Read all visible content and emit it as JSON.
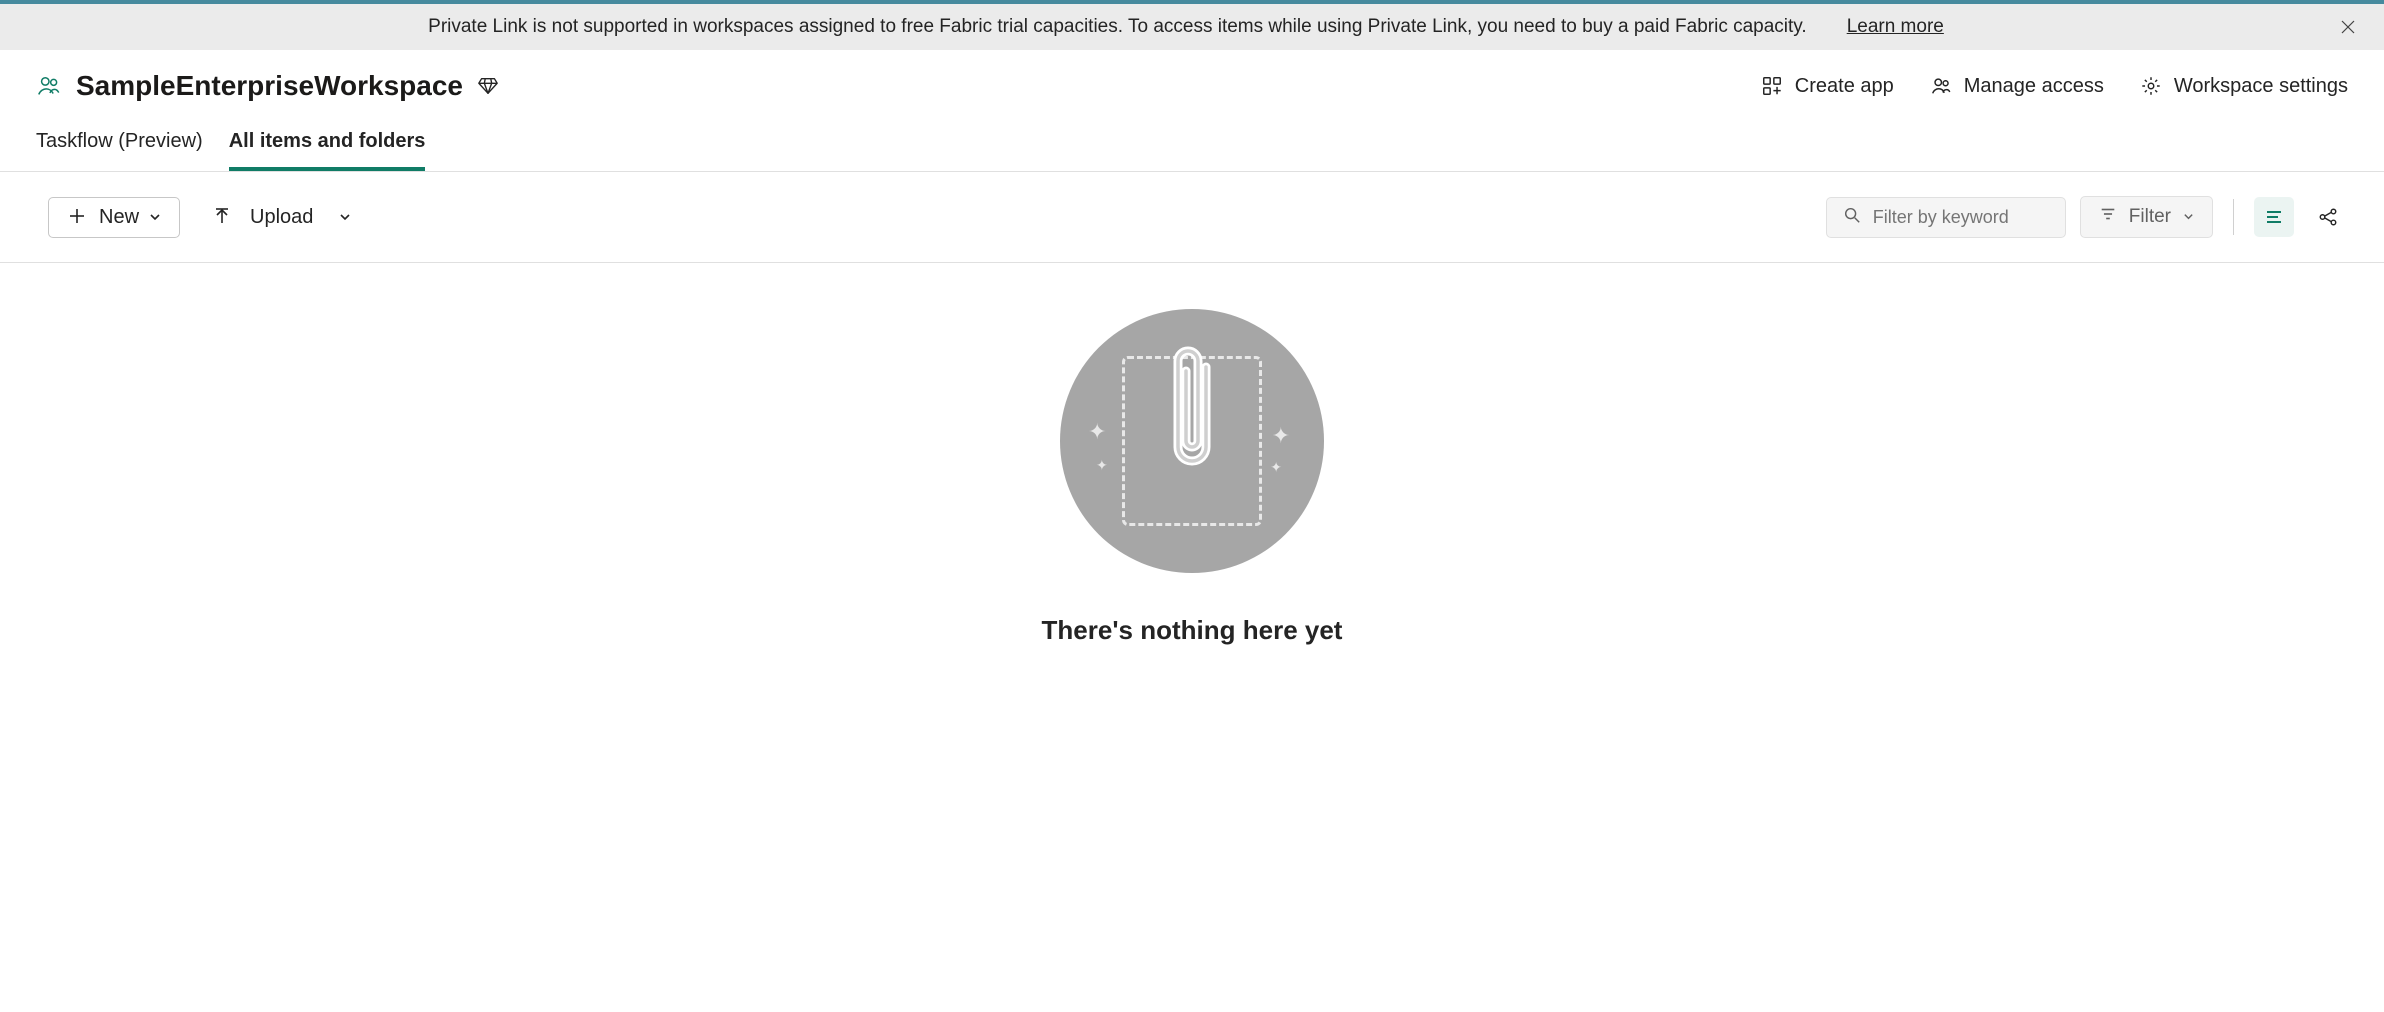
{
  "notification": {
    "message": "Private Link is not supported in workspaces assigned to free Fabric trial capacities. To access items while using Private Link, you need to buy a paid Fabric capacity.",
    "learn_more": "Learn more"
  },
  "workspace": {
    "title": "SampleEnterpriseWorkspace"
  },
  "header_actions": {
    "create_app": "Create app",
    "manage_access": "Manage access",
    "workspace_settings": "Workspace settings"
  },
  "tabs": {
    "taskflow": "Taskflow (Preview)",
    "all_items": "All items and folders"
  },
  "toolbar": {
    "new_label": "New",
    "upload_label": "Upload",
    "filter_placeholder": "Filter by keyword",
    "filter_btn": "Filter"
  },
  "empty_state": {
    "title": "There's nothing here yet"
  },
  "colors": {
    "accent": "#107c66",
    "banner_accent": "#468a9e"
  }
}
